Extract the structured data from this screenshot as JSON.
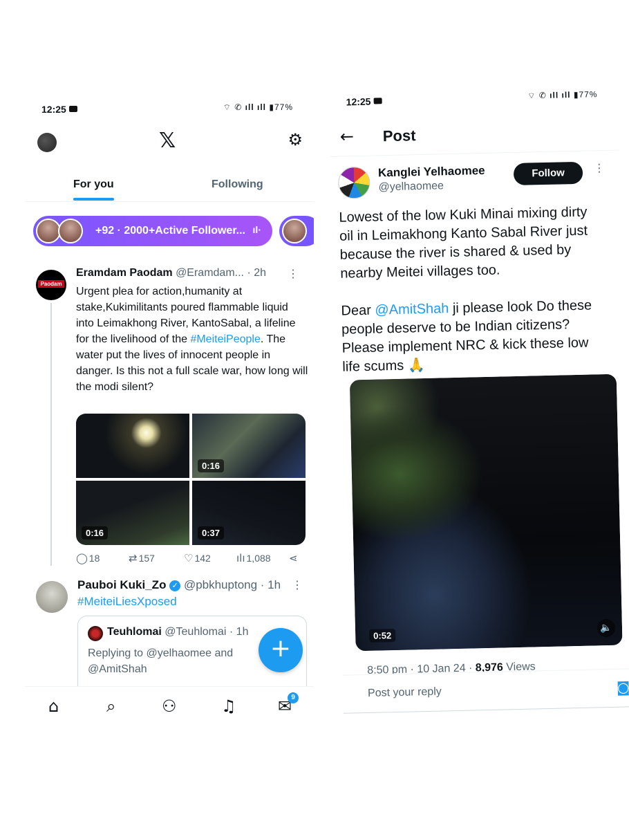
{
  "left": {
    "status": {
      "time": "12:25",
      "battery": "77%"
    },
    "header": {
      "logo": "𝕏",
      "settings_icon": "⚙"
    },
    "tabs": [
      {
        "label": "For you"
      },
      {
        "label": "Following"
      }
    ],
    "spaces_pill": {
      "text": "+92 · 2000+Active Follower...",
      "eq": "ıl·"
    },
    "tweet1": {
      "avatar_label": "Paodam",
      "name": "Eramdam Paodam",
      "handle": "@Eramdam...",
      "time": "· 2h",
      "text_a": "Urgent plea for action,humanity at stake,Kukimilitants poured flammable liquid into Leimakhong River, KantoSabal, a lifeline for the livelihood of the ",
      "hashtag": "#MeiteiPeople",
      "text_b": ". The water put the lives of innocent people in danger. Is this not a full scale war, how long will the modi silent?",
      "media_durations": [
        "",
        "0:16",
        "0:16",
        "0:37"
      ],
      "replies": "18",
      "reposts": "157",
      "likes": "142",
      "views": "1,088"
    },
    "tweet2": {
      "name": "Pauboi Kuki_Zo",
      "handle": "@pbkhuptong",
      "time": "· 1h",
      "hashtag": "#MeiteiLiesXposed",
      "quote": {
        "name": "Teuhlomai",
        "handle": "@Teuhlomai",
        "time": "· 1h",
        "text": "Replying to @yelhaomee and @AmitShah"
      }
    },
    "fab_icon": "+",
    "nav": {
      "messages_badge": "9"
    }
  },
  "right": {
    "status": {
      "time": "12:25",
      "battery": "77%"
    },
    "header": {
      "back": "←",
      "title": "Post"
    },
    "author": {
      "name": "Kanglei Yelhaomee",
      "handle": "@yelhaomee",
      "follow_label": "Follow"
    },
    "text_p1": "Lowest of the low Kuki Minai mixing dirty oil in Leimakhong Kanto Sabal River just because the river is shared & used by nearby Meitei villages too.",
    "text_p2_a": "Dear ",
    "mention": "@AmitShah",
    "text_p2_b": " ji please look Do these people deserve to be Indian citizens? Please implement NRC & kick these low life scums 🙏",
    "video_duration": "0:52",
    "meta_date": "8:50 pm · 10 Jan 24 · ",
    "meta_views": "8,976",
    "meta_views_label": " Views",
    "reply_placeholder": "Post your reply"
  }
}
